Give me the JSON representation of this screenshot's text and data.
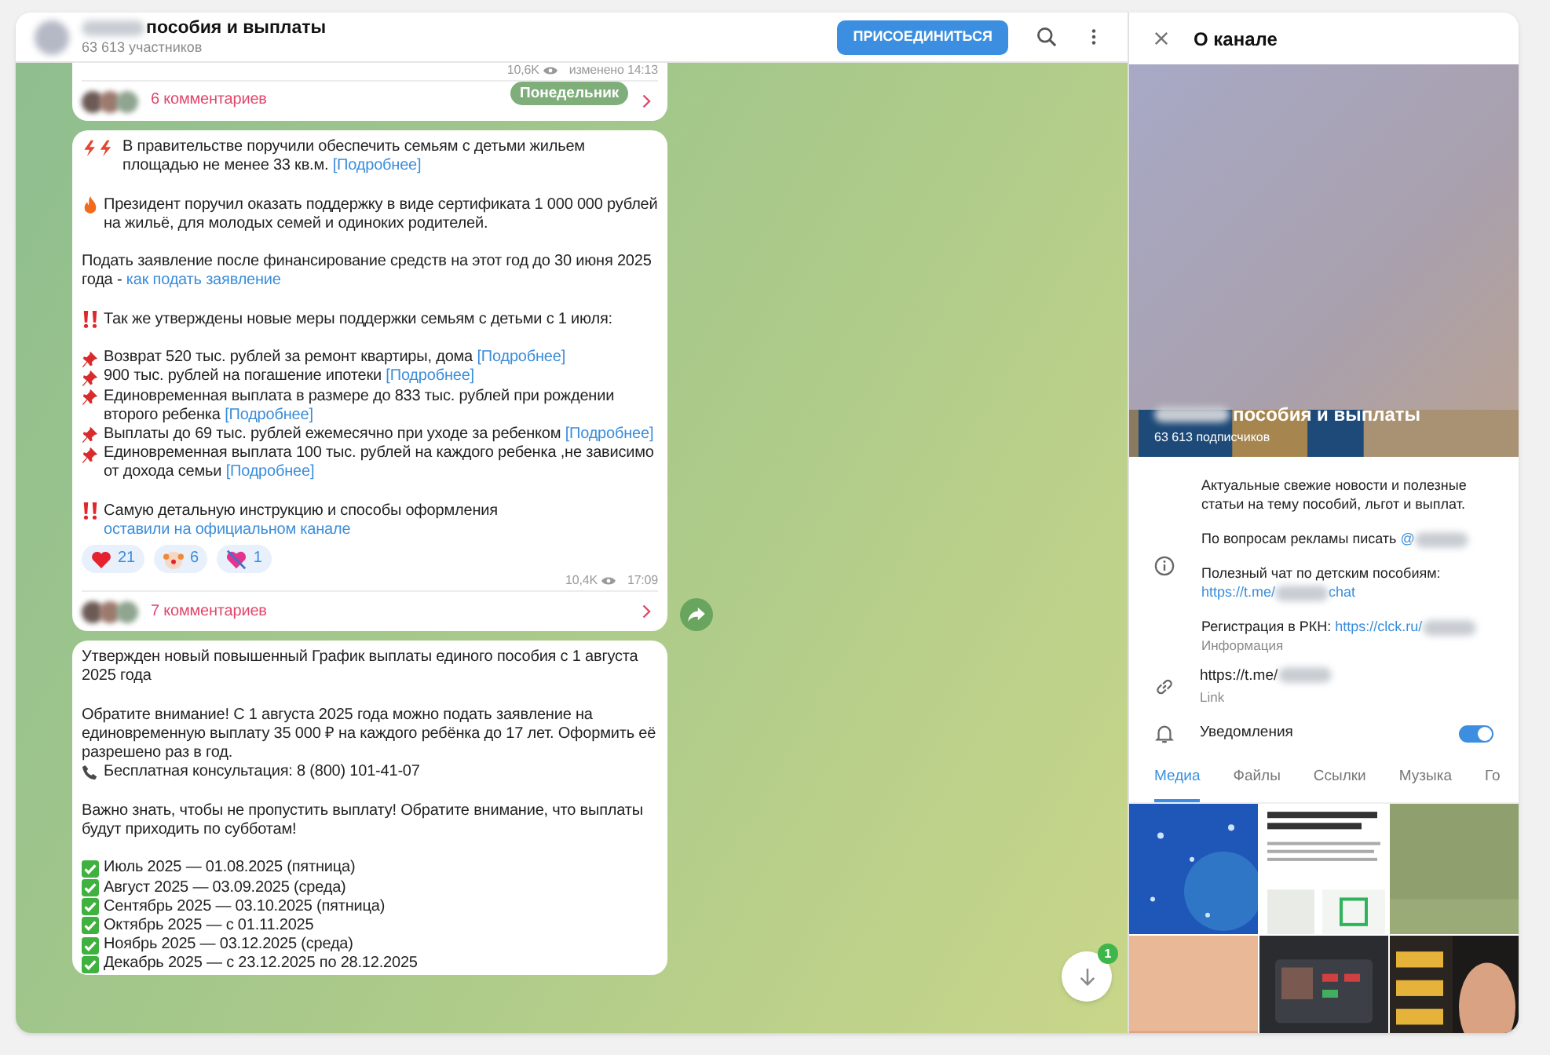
{
  "header": {
    "title": "пособия и выплаты",
    "subtitle": "63 613 участников",
    "join_button": "ПРИСОЕДИНИТЬСЯ"
  },
  "date_pill": "Понедельник",
  "messages": [
    {
      "views": "10,6K",
      "time": "изменено 14:13",
      "comments": "6 комментариев"
    },
    {
      "views": "10,4K",
      "time": "17:09",
      "comments": "7 комментариев",
      "share": true,
      "reactions": [
        {
          "kind": "heart",
          "count": "21"
        },
        {
          "kind": "clown",
          "count": "6"
        },
        {
          "kind": "heart_arrow",
          "count": "1"
        }
      ],
      "groups": [
        [
          {
            "kind": "bolts",
            "text": "В правительстве поручили обеспечить семьям с детьми жильем площадью не менее 33 кв.м. ",
            "link": "[Подробнее]"
          }
        ],
        [
          {
            "kind": "fire",
            "text": "Президент поручил оказать поддержку в виде сертификата 1 000 000 рублей на жильё, для молодых семей и одиноких родителей."
          }
        ],
        [
          {
            "kind": "plain",
            "text": "Подать заявление после финансирование средств на этот год до 30 июня 2025 года - ",
            "link": "как подать заявление"
          }
        ],
        [
          {
            "kind": "bangbang",
            "text": "Так же утверждены новые меры поддержки семьям с детьми с 1 июля:"
          }
        ],
        [
          {
            "kind": "pin",
            "text": "Возврат 520 тыс. рублей за ремонт квартиры, дома ",
            "link": "[Подробнее]"
          },
          {
            "kind": "pin",
            "text": "900 тыс. рублей на погашение ипотеки ",
            "link": "[Подробнее]"
          },
          {
            "kind": "pin",
            "text": "Единовременная выплата в размере до 833 тыс. рублей при рождении второго ребенка ",
            "link": "[Подробнее]"
          },
          {
            "kind": "pin",
            "text": "Выплаты до 69 тыс. рублей ежемесячно при уходе за ребенком ",
            "link": "[Подробнее]"
          },
          {
            "kind": "pin",
            "text": "Единовременная выплата 100 тыс. рублей на каждого ребенка ,не зависимо от дохода семьи ",
            "link": "[Подробнее]"
          }
        ],
        [
          {
            "kind": "bangbang",
            "text": "Самую детальную инструкцию и способы оформления ",
            "link": "оставили на официальном канале"
          }
        ]
      ]
    },
    {
      "groups": [
        [
          {
            "kind": "plain",
            "text": "Утвержден новый повышенный График выплаты единого пособия с 1 августа 2025 года"
          }
        ],
        [
          {
            "kind": "plain",
            "text": "Обратите внимание! С 1 августа 2025 года можно подать заявление на единовременную выплату 35 000 ₽ на каждого ребёнка до 17 лет. Оформить её разрешено раз в год."
          },
          {
            "kind": "phone",
            "text": "Бесплатная консультация: 8 (800) 101-41-07"
          }
        ],
        [
          {
            "kind": "plain",
            "text": "Важно знать, чтобы не пропустить выплату! Обратите внимание, что выплаты будут приходить по субботам!"
          }
        ],
        [
          {
            "kind": "check",
            "text": "Июль 2025 — 01.08.2025 (пятница)"
          },
          {
            "kind": "check",
            "text": "Август 2025 — 03.09.2025 (среда)"
          },
          {
            "kind": "check",
            "text": "Сентябрь 2025 — 03.10.2025 (пятница)"
          },
          {
            "kind": "check",
            "text": "Октябрь 2025 — с 01.11.2025"
          },
          {
            "kind": "check",
            "text": "Ноябрь 2025 — 03.12.2025 (среда)"
          },
          {
            "kind": "check",
            "text": "Декабрь 2025 — с 23.12.2025 по 28.12.2025"
          }
        ]
      ]
    }
  ],
  "scroll_badge": "1",
  "panel": {
    "title": "О канале",
    "name": "пособия и выплаты",
    "subscribers": "63 613 подписчиков",
    "info": [
      [
        {
          "kind": "text",
          "text": "Актуальные свежие новости и полезные статьи на тему пособий, льгот и выплат."
        }
      ],
      [
        {
          "kind": "text",
          "text": "По вопросам рекламы писать "
        },
        {
          "kind": "link",
          "text": "@"
        },
        {
          "kind": "blur"
        }
      ],
      [
        {
          "kind": "text",
          "text": "Полезный чат по детским пособиям: "
        },
        {
          "kind": "link",
          "text": "https://t.me/"
        },
        {
          "kind": "blur"
        },
        {
          "kind": "link",
          "text": "chat"
        }
      ],
      [
        {
          "kind": "text",
          "text": "Регистрация в РКН: "
        },
        {
          "kind": "link",
          "text": "https://clck.ru/"
        },
        {
          "kind": "blur"
        }
      ]
    ],
    "info_caption": "Информация",
    "link": [
      {
        "kind": "text",
        "text": "https://t.me/"
      },
      {
        "kind": "blur"
      }
    ],
    "link_caption": "Link",
    "notifications": {
      "label": "Уведомления",
      "on": true
    },
    "tabs": [
      {
        "label": "Медиа",
        "selected": true
      },
      {
        "label": "Файлы",
        "selected": false
      },
      {
        "label": "Ссылки",
        "selected": false
      },
      {
        "label": "Музыка",
        "selected": false
      },
      {
        "label": "Го",
        "selected": false
      }
    ],
    "media": [
      {
        "kind": "picture"
      },
      {
        "kind": "picture"
      },
      {
        "kind": "picture"
      },
      {
        "kind": "picture"
      },
      {
        "kind": "picture"
      },
      {
        "kind": "picture"
      }
    ]
  }
}
